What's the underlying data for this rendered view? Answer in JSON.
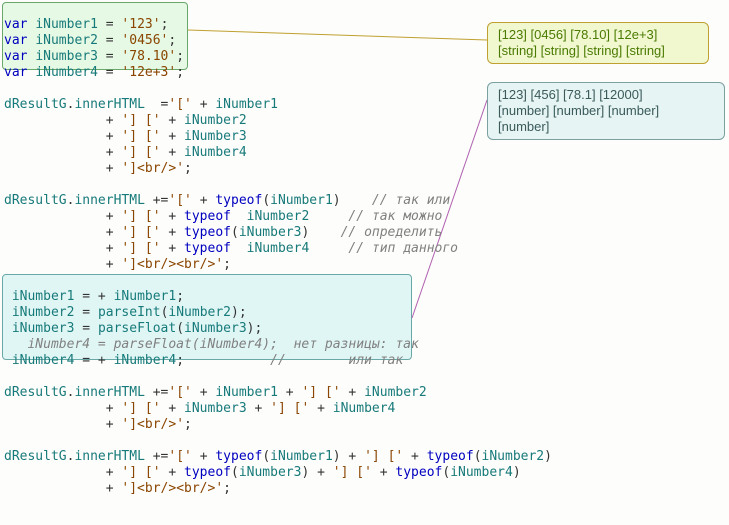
{
  "code_lines": [
    {
      "tokens": [
        {
          "c": "k",
          "t": "var"
        },
        {
          "c": "op",
          "t": " "
        },
        {
          "c": "var",
          "t": "iNumber1"
        },
        {
          "c": "op",
          "t": " = "
        },
        {
          "c": "str",
          "t": "'123'"
        },
        {
          "c": "op",
          "t": ";"
        }
      ]
    },
    {
      "tokens": [
        {
          "c": "k",
          "t": "var"
        },
        {
          "c": "op",
          "t": " "
        },
        {
          "c": "var",
          "t": "iNumber2"
        },
        {
          "c": "op",
          "t": " = "
        },
        {
          "c": "str",
          "t": "'0456'"
        },
        {
          "c": "op",
          "t": ";"
        }
      ]
    },
    {
      "tokens": [
        {
          "c": "k",
          "t": "var"
        },
        {
          "c": "op",
          "t": " "
        },
        {
          "c": "var",
          "t": "iNumber3"
        },
        {
          "c": "op",
          "t": " = "
        },
        {
          "c": "str",
          "t": "'78.10'"
        },
        {
          "c": "op",
          "t": ";"
        }
      ]
    },
    {
      "tokens": [
        {
          "c": "k",
          "t": "var"
        },
        {
          "c": "op",
          "t": " "
        },
        {
          "c": "var",
          "t": "iNumber4"
        },
        {
          "c": "op",
          "t": " = "
        },
        {
          "c": "str",
          "t": "'12e+3'"
        },
        {
          "c": "op",
          "t": ";"
        }
      ]
    },
    {
      "blank": true
    },
    {
      "tokens": [
        {
          "c": "var",
          "t": "dResultG"
        },
        {
          "c": "op",
          "t": "."
        },
        {
          "c": "var",
          "t": "innerHTML"
        },
        {
          "c": "op",
          "t": "  ="
        },
        {
          "c": "str",
          "t": "'['"
        },
        {
          "c": "op",
          "t": " + "
        },
        {
          "c": "var",
          "t": "iNumber1"
        }
      ]
    },
    {
      "tokens": [
        {
          "c": "op",
          "t": "             + "
        },
        {
          "c": "str",
          "t": "'] ['"
        },
        {
          "c": "op",
          "t": " + "
        },
        {
          "c": "var",
          "t": "iNumber2"
        }
      ]
    },
    {
      "tokens": [
        {
          "c": "op",
          "t": "             + "
        },
        {
          "c": "str",
          "t": "'] ['"
        },
        {
          "c": "op",
          "t": " + "
        },
        {
          "c": "var",
          "t": "iNumber3"
        }
      ]
    },
    {
      "tokens": [
        {
          "c": "op",
          "t": "             + "
        },
        {
          "c": "str",
          "t": "'] ['"
        },
        {
          "c": "op",
          "t": " + "
        },
        {
          "c": "var",
          "t": "iNumber4"
        }
      ]
    },
    {
      "tokens": [
        {
          "c": "op",
          "t": "             + "
        },
        {
          "c": "str",
          "t": "']<br/>'"
        },
        {
          "c": "op",
          "t": ";"
        }
      ]
    },
    {
      "blank": true
    },
    {
      "tokens": [
        {
          "c": "var",
          "t": "dResultG"
        },
        {
          "c": "op",
          "t": "."
        },
        {
          "c": "var",
          "t": "innerHTML"
        },
        {
          "c": "op",
          "t": " +="
        },
        {
          "c": "str",
          "t": "'['"
        },
        {
          "c": "op",
          "t": " + "
        },
        {
          "c": "k",
          "t": "typeof"
        },
        {
          "c": "op",
          "t": "("
        },
        {
          "c": "var",
          "t": "iNumber1"
        },
        {
          "c": "op",
          "t": ")    "
        },
        {
          "c": "cmt",
          "t": "// так или"
        }
      ]
    },
    {
      "tokens": [
        {
          "c": "op",
          "t": "             + "
        },
        {
          "c": "str",
          "t": "'] ['"
        },
        {
          "c": "op",
          "t": " + "
        },
        {
          "c": "k",
          "t": "typeof"
        },
        {
          "c": "op",
          "t": "  "
        },
        {
          "c": "var",
          "t": "iNumber2"
        },
        {
          "c": "op",
          "t": "     "
        },
        {
          "c": "cmt",
          "t": "// так можно"
        }
      ]
    },
    {
      "tokens": [
        {
          "c": "op",
          "t": "             + "
        },
        {
          "c": "str",
          "t": "'] ['"
        },
        {
          "c": "op",
          "t": " + "
        },
        {
          "c": "k",
          "t": "typeof"
        },
        {
          "c": "op",
          "t": "("
        },
        {
          "c": "var",
          "t": "iNumber3"
        },
        {
          "c": "op",
          "t": ")    "
        },
        {
          "c": "cmt",
          "t": "// определить"
        }
      ]
    },
    {
      "tokens": [
        {
          "c": "op",
          "t": "             + "
        },
        {
          "c": "str",
          "t": "'] ['"
        },
        {
          "c": "op",
          "t": " + "
        },
        {
          "c": "k",
          "t": "typeof"
        },
        {
          "c": "op",
          "t": "  "
        },
        {
          "c": "var",
          "t": "iNumber4"
        },
        {
          "c": "op",
          "t": "     "
        },
        {
          "c": "cmt",
          "t": "// тип данного"
        }
      ]
    },
    {
      "tokens": [
        {
          "c": "op",
          "t": "             + "
        },
        {
          "c": "str",
          "t": "']<br/><br/>'"
        },
        {
          "c": "op",
          "t": ";"
        }
      ]
    },
    {
      "blank": true
    },
    {
      "tokens": [
        {
          "c": "op",
          "t": " "
        },
        {
          "c": "var",
          "t": "iNumber1"
        },
        {
          "c": "op",
          "t": " = + "
        },
        {
          "c": "var",
          "t": "iNumber1"
        },
        {
          "c": "op",
          "t": ";"
        }
      ]
    },
    {
      "tokens": [
        {
          "c": "op",
          "t": " "
        },
        {
          "c": "var",
          "t": "iNumber2"
        },
        {
          "c": "op",
          "t": " = "
        },
        {
          "c": "var",
          "t": "parseInt"
        },
        {
          "c": "op",
          "t": "("
        },
        {
          "c": "var",
          "t": "iNumber2"
        },
        {
          "c": "op",
          "t": ");"
        }
      ]
    },
    {
      "tokens": [
        {
          "c": "op",
          "t": " "
        },
        {
          "c": "var",
          "t": "iNumber3"
        },
        {
          "c": "op",
          "t": " = "
        },
        {
          "c": "var",
          "t": "parseFloat"
        },
        {
          "c": "op",
          "t": "("
        },
        {
          "c": "var",
          "t": "iNumber3"
        },
        {
          "c": "op",
          "t": ");"
        }
      ]
    },
    {
      "tokens": [
        {
          "c": "cmt",
          "t": "   iNumber4 = parseFloat(iNumber4);  нет разницы: так"
        }
      ]
    },
    {
      "tokens": [
        {
          "c": "op",
          "t": " "
        },
        {
          "c": "var",
          "t": "iNumber4"
        },
        {
          "c": "op",
          "t": " = + "
        },
        {
          "c": "var",
          "t": "iNumber4"
        },
        {
          "c": "op",
          "t": ";           "
        },
        {
          "c": "cmt",
          "t": "//        или так"
        }
      ]
    },
    {
      "blank": true
    },
    {
      "tokens": [
        {
          "c": "var",
          "t": "dResultG"
        },
        {
          "c": "op",
          "t": "."
        },
        {
          "c": "var",
          "t": "innerHTML"
        },
        {
          "c": "op",
          "t": " +="
        },
        {
          "c": "str",
          "t": "'['"
        },
        {
          "c": "op",
          "t": " + "
        },
        {
          "c": "var",
          "t": "iNumber1"
        },
        {
          "c": "op",
          "t": " + "
        },
        {
          "c": "str",
          "t": "'] ['"
        },
        {
          "c": "op",
          "t": " + "
        },
        {
          "c": "var",
          "t": "iNumber2"
        }
      ]
    },
    {
      "tokens": [
        {
          "c": "op",
          "t": "             + "
        },
        {
          "c": "str",
          "t": "'] ['"
        },
        {
          "c": "op",
          "t": " + "
        },
        {
          "c": "var",
          "t": "iNumber3"
        },
        {
          "c": "op",
          "t": " + "
        },
        {
          "c": "str",
          "t": "'] ['"
        },
        {
          "c": "op",
          "t": " + "
        },
        {
          "c": "var",
          "t": "iNumber4"
        }
      ]
    },
    {
      "tokens": [
        {
          "c": "op",
          "t": "             + "
        },
        {
          "c": "str",
          "t": "']<br/>'"
        },
        {
          "c": "op",
          "t": ";"
        }
      ]
    },
    {
      "blank": true
    },
    {
      "tokens": [
        {
          "c": "var",
          "t": "dResultG"
        },
        {
          "c": "op",
          "t": "."
        },
        {
          "c": "var",
          "t": "innerHTML"
        },
        {
          "c": "op",
          "t": " +="
        },
        {
          "c": "str",
          "t": "'['"
        },
        {
          "c": "op",
          "t": " + "
        },
        {
          "c": "k",
          "t": "typeof"
        },
        {
          "c": "op",
          "t": "("
        },
        {
          "c": "var",
          "t": "iNumber1"
        },
        {
          "c": "op",
          "t": ") + "
        },
        {
          "c": "str",
          "t": "'] ['"
        },
        {
          "c": "op",
          "t": " + "
        },
        {
          "c": "k",
          "t": "typeof"
        },
        {
          "c": "op",
          "t": "("
        },
        {
          "c": "var",
          "t": "iNumber2"
        },
        {
          "c": "op",
          "t": ")"
        }
      ]
    },
    {
      "tokens": [
        {
          "c": "op",
          "t": "             + "
        },
        {
          "c": "str",
          "t": "'] ['"
        },
        {
          "c": "op",
          "t": " + "
        },
        {
          "c": "k",
          "t": "typeof"
        },
        {
          "c": "op",
          "t": "("
        },
        {
          "c": "var",
          "t": "iNumber3"
        },
        {
          "c": "op",
          "t": ") + "
        },
        {
          "c": "str",
          "t": "'] ['"
        },
        {
          "c": "op",
          "t": " + "
        },
        {
          "c": "k",
          "t": "typeof"
        },
        {
          "c": "op",
          "t": "("
        },
        {
          "c": "var",
          "t": "iNumber4"
        },
        {
          "c": "op",
          "t": ")"
        }
      ]
    },
    {
      "tokens": [
        {
          "c": "op",
          "t": "             + "
        },
        {
          "c": "str",
          "t": "']<br/><br/>'"
        },
        {
          "c": "op",
          "t": ";"
        }
      ]
    }
  ],
  "callouts": {
    "green": {
      "line1": "[123] [0456] [78.10] [12e+3]",
      "line2": "[string] [string] [string] [string]"
    },
    "teal": {
      "line1": "[123] [456] [78.1] [12000]",
      "line2": "[number] [number] [number] [number]"
    }
  }
}
